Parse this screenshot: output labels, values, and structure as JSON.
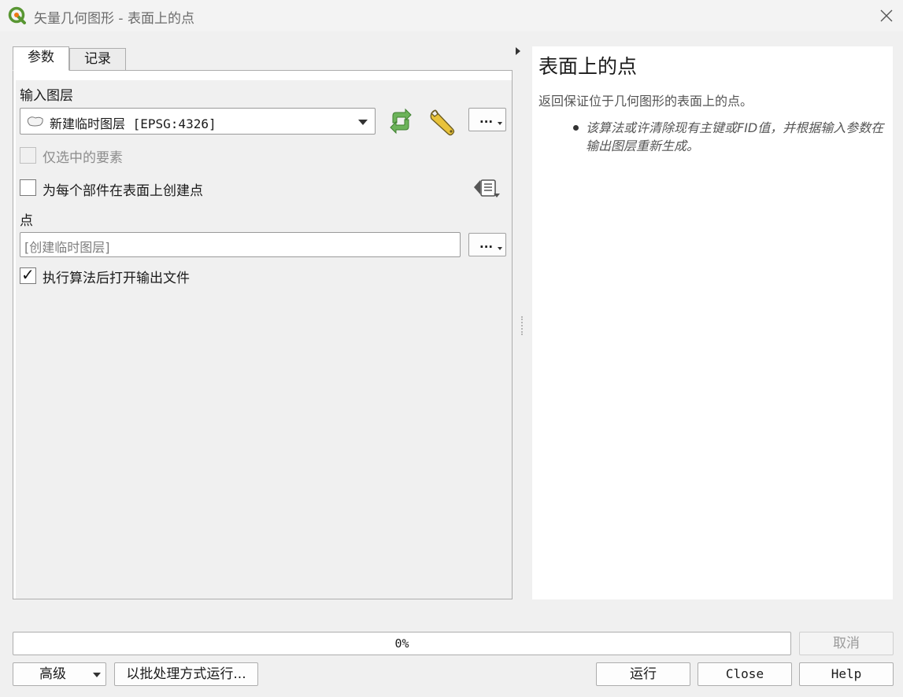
{
  "window": {
    "title": "矢量几何图形 - 表面上的点"
  },
  "tabs": [
    {
      "label": "参数"
    },
    {
      "label": "记录"
    }
  ],
  "params": {
    "input_layer_label": "输入图层",
    "input_layer_value": "新建临时图层 [EPSG:4326]",
    "selected_only_label": "仅选中的要素",
    "selected_only_checked": false,
    "per_part_label": "为每个部件在表面上创建点",
    "per_part_checked": false,
    "output_label": "点",
    "output_placeholder": "[创建临时图层]",
    "open_output_label": "执行算法后打开输出文件",
    "open_output_checked": true
  },
  "help": {
    "title": "表面上的点",
    "description": "返回保证位于几何图形的表面上的点。",
    "bullets": [
      "该算法或许清除现有主键或FID值，并根据输入参数在输出图层重新生成。"
    ]
  },
  "progress": {
    "text": "0%",
    "value": 0
  },
  "buttons": {
    "cancel": "取消",
    "advanced": "高级",
    "batch": "以批处理方式运行...",
    "run": "运行",
    "close": "Close",
    "help": "Help"
  },
  "colors": {
    "qgis_green": "#589632",
    "qgis_yellow": "#ee7913",
    "iterate_green": "#5aa14a"
  },
  "icons": {
    "app": "qgis-logo-icon",
    "close": "close-icon",
    "layer": "polygon-layer-icon",
    "iterate": "iterate-icon",
    "settings": "wrench-icon",
    "more": "ellipsis-icon",
    "expression": "expression-icon"
  }
}
